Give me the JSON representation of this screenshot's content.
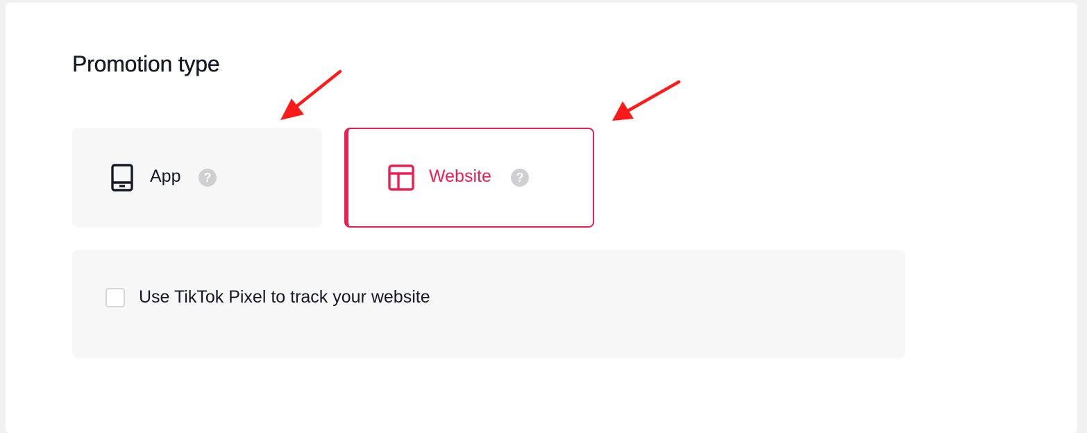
{
  "promotion": {
    "title": "Promotion type",
    "options": [
      {
        "label": "App",
        "icon": "tablet-icon",
        "selected": false
      },
      {
        "label": "Website",
        "icon": "layout-icon",
        "selected": true
      }
    ],
    "help_glyph": "?"
  },
  "pixel": {
    "label": "Use TikTok Pixel to track your website",
    "checked": false
  },
  "colors": {
    "accent": "#ee1d52",
    "text": "#161823",
    "card_bg": "#f7f7f7",
    "annotation": "#ff1a1a"
  }
}
